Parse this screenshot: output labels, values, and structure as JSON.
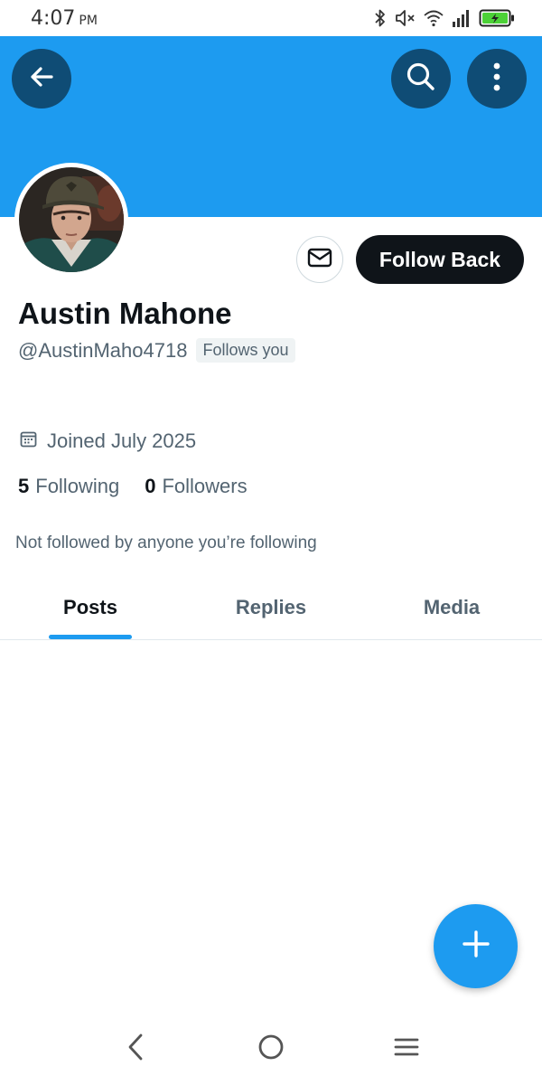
{
  "status_bar": {
    "time": "4:07",
    "ampm": "PM",
    "battery_color": "#4cd137",
    "icons": [
      "bluetooth-icon",
      "mute-icon",
      "wifi-icon",
      "signal-icon",
      "battery-charging-icon"
    ]
  },
  "header": {
    "banner_color": "#1d9bf0",
    "back_icon": "arrow-left-icon",
    "search_icon": "search-icon",
    "more_icon": "more-vertical-icon"
  },
  "profile": {
    "display_name": "Austin Mahone",
    "handle": "@AustinMaho4718",
    "follows_you_badge": "Follows you",
    "joined": "Joined July 2025",
    "following_count": "5",
    "following_label": "Following",
    "followers_count": "0",
    "followers_label": "Followers",
    "mutuals_text": "Not followed by anyone you’re following"
  },
  "actions": {
    "message_icon": "envelope-icon",
    "follow_label": "Follow Back"
  },
  "tabs": [
    {
      "label": "Posts",
      "active": true
    },
    {
      "label": "Replies",
      "active": false
    },
    {
      "label": "Media",
      "active": false
    }
  ],
  "fab": {
    "icon": "plus-icon",
    "color": "#1d9bf0"
  },
  "nav_bar": {
    "icons": [
      "nav-back-icon",
      "nav-home-icon",
      "nav-recents-icon"
    ]
  }
}
